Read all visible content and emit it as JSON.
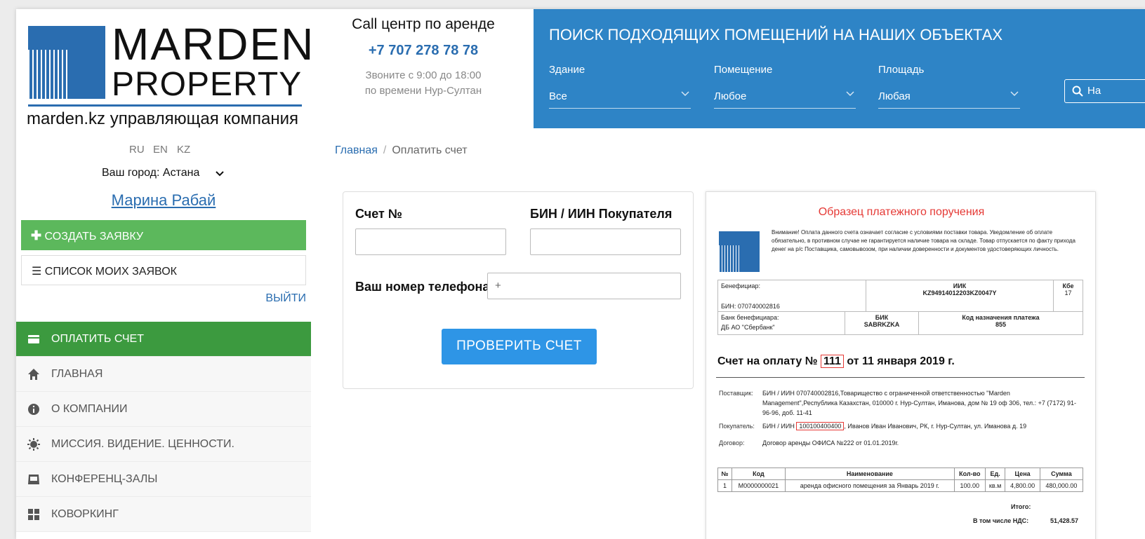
{
  "header": {
    "logo_word1": "MARDEN",
    "logo_word2": "PROPERTY",
    "logo_tagline": "marden.kz управляющая компания",
    "call_center_title": "Call центр по аренде",
    "call_center_phone": "+7 707 278 78 78",
    "call_center_hours_line1": "Звоните с 9:00 до 18:00",
    "call_center_hours_line2": "по времени Нур-Султан"
  },
  "search": {
    "title": "ПОИСК ПОДХОДЯЩИХ ПОМЕЩЕНИЙ НА НАШИХ ОБЪЕКТАХ",
    "fields": [
      {
        "label": "Здание",
        "value": "Все"
      },
      {
        "label": "Помещение",
        "value": "Любое"
      },
      {
        "label": "Площадь",
        "value": "Любая"
      }
    ],
    "button_label": "На"
  },
  "sidebar": {
    "languages": [
      "RU",
      "EN",
      "KZ"
    ],
    "city": "Ваш город: Астана",
    "user_name": "Марина Рабай",
    "create_label": "СОЗДАТЬ ЗАЯВКУ",
    "list_label": "СПИСОК МОИХ ЗАЯВОК",
    "logout_label": "ВЫЙТИ",
    "menu": [
      {
        "label": "ОПЛАТИТЬ СЧЕТ",
        "icon": "card-icon",
        "active": true
      },
      {
        "label": "ГЛАВНАЯ",
        "icon": "home-icon",
        "active": false
      },
      {
        "label": "О КОМПАНИИ",
        "icon": "info-icon",
        "active": false
      },
      {
        "label": "МИССИЯ. ВИДЕНИЕ. ЦЕННОСТИ.",
        "icon": "sun-icon",
        "active": false
      },
      {
        "label": "КОНФЕРЕНЦ-ЗАЛЫ",
        "icon": "inbox-icon",
        "active": false
      },
      {
        "label": "КОВОРКИНГ",
        "icon": "grid-icon",
        "active": false
      }
    ]
  },
  "breadcrumb": {
    "home": "Главная",
    "separator": "/",
    "current": "Оплатить счет"
  },
  "form": {
    "invoice_label": "Счет №",
    "bin_label": "БИН / ИИН Покупателя",
    "phone_label": "Ваш номер телефона",
    "phone_value": "+",
    "check_button": "ПРОВЕРИТЬ СЧЕТ"
  },
  "invoice_sample": {
    "title": "Образец платежного поручения",
    "warning": "Внимание! Оплата данного счета означает согласие с условиями поставки товара. Уведомление об оплате обязательно, в противном случае не гарантируется наличие товара на складе. Товар отпускается по факту прихода денег на р/с Поставщика, самовывозом, при наличии доверенности и документов удостоверяющих личность.",
    "beneficiary_label": "Бенефициар:",
    "beneficiary_bin": "БИН: 070740002816",
    "iik_label": "ИИК",
    "iik_value": "KZ94914012203KZ0047Y",
    "kbe_label": "Кбе",
    "kbe_value": "17",
    "bank_label": "Банк бенефициара:",
    "bank_value": "ДБ АО \"Сбербанк\"",
    "bik_label": "БИК",
    "bik_value": "SABRKZKA",
    "knp_label": "Код назначения платежа",
    "knp_value": "855",
    "heading_prefix": "Счет на оплату №",
    "heading_number": "111",
    "heading_suffix": "от 11 января 2019 г.",
    "supplier_label": "Поставщик:",
    "supplier_value": "БИН / ИИН 070740002816,Товарищество с ограниченной ответственностью \"Marden Management\",Республика Казахстан, 010000 г. Нур-Султан, Иманова, дом № 19 оф 306, тел.: +7 (7172) 91-96-96, доб. 11-41",
    "buyer_label": "Покупатель:",
    "buyer_prefix": "БИН / ИИН",
    "buyer_bin": "100100400400",
    "buyer_suffix": ", Иванов Иван Иванович, РК, г. Нур-Султан, ул. Иманова д. 19",
    "contract_label": "Договор:",
    "contract_value": "Договор аренды ОФИСА №222 от 01.01.2019г.",
    "table_headers": [
      "№",
      "Код",
      "Наименование",
      "Кол-во",
      "Ед.",
      "Цена",
      "Сумма"
    ],
    "table_rows": [
      [
        "1",
        "М0000000021",
        "аренда офисного помещения за Январь 2019 г.",
        "100.00",
        "кв.м",
        "4,800.00",
        "480,000.00"
      ]
    ],
    "total_label": "Итого:",
    "vat_label": "В том числе НДС:",
    "vat_value": "51,428.57"
  }
}
